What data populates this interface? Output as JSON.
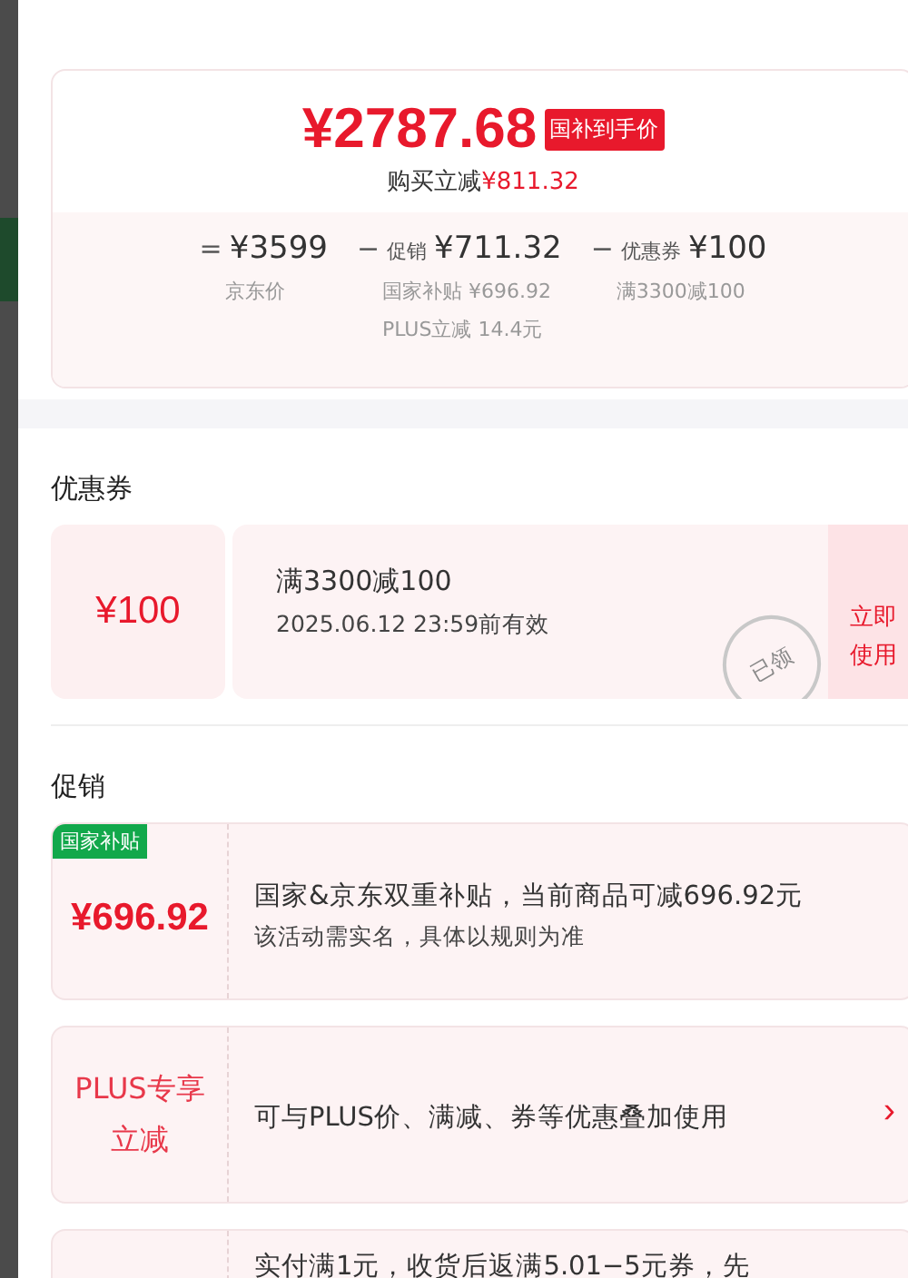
{
  "summary": {
    "price": "¥2787.68",
    "price_tag": "国补到手价",
    "saving_label": "购买立减",
    "saving_value": "¥811.32",
    "breakdown": [
      {
        "op": "=",
        "value": "¥3599",
        "notes": [
          "京东价"
        ]
      },
      {
        "op": "−",
        "label": "促销",
        "value": "¥711.32",
        "notes": [
          "国家补贴 ¥696.92",
          "PLUS立减 14.4元"
        ]
      },
      {
        "op": "−",
        "label": "优惠券",
        "value": "¥100",
        "notes": [
          "满3300减100"
        ]
      }
    ]
  },
  "coupons": {
    "heading": "优惠券",
    "items": [
      {
        "amount": "¥100",
        "title": "满3300减100",
        "validity": "2025.06.12 23:59前有效",
        "stamp": "已领",
        "action": "立即使用"
      }
    ]
  },
  "promotions": {
    "heading": "促销",
    "items": [
      {
        "kind": "amount",
        "tag": "国家补贴",
        "amount": "¥696.92",
        "lines": [
          "国家&京东双重补贴，当前商品可减696.92元",
          "该活动需实名，具体以规则为准"
        ]
      },
      {
        "kind": "label",
        "label": "PLUS专享立减",
        "lines": [
          "可与PLUS价、满减、券等优惠叠加使用"
        ],
        "chevron": "›"
      },
      {
        "kind": "empty",
        "lines": [
          "实付满1元，收货后返满5.01−5元券，先"
        ]
      }
    ]
  }
}
